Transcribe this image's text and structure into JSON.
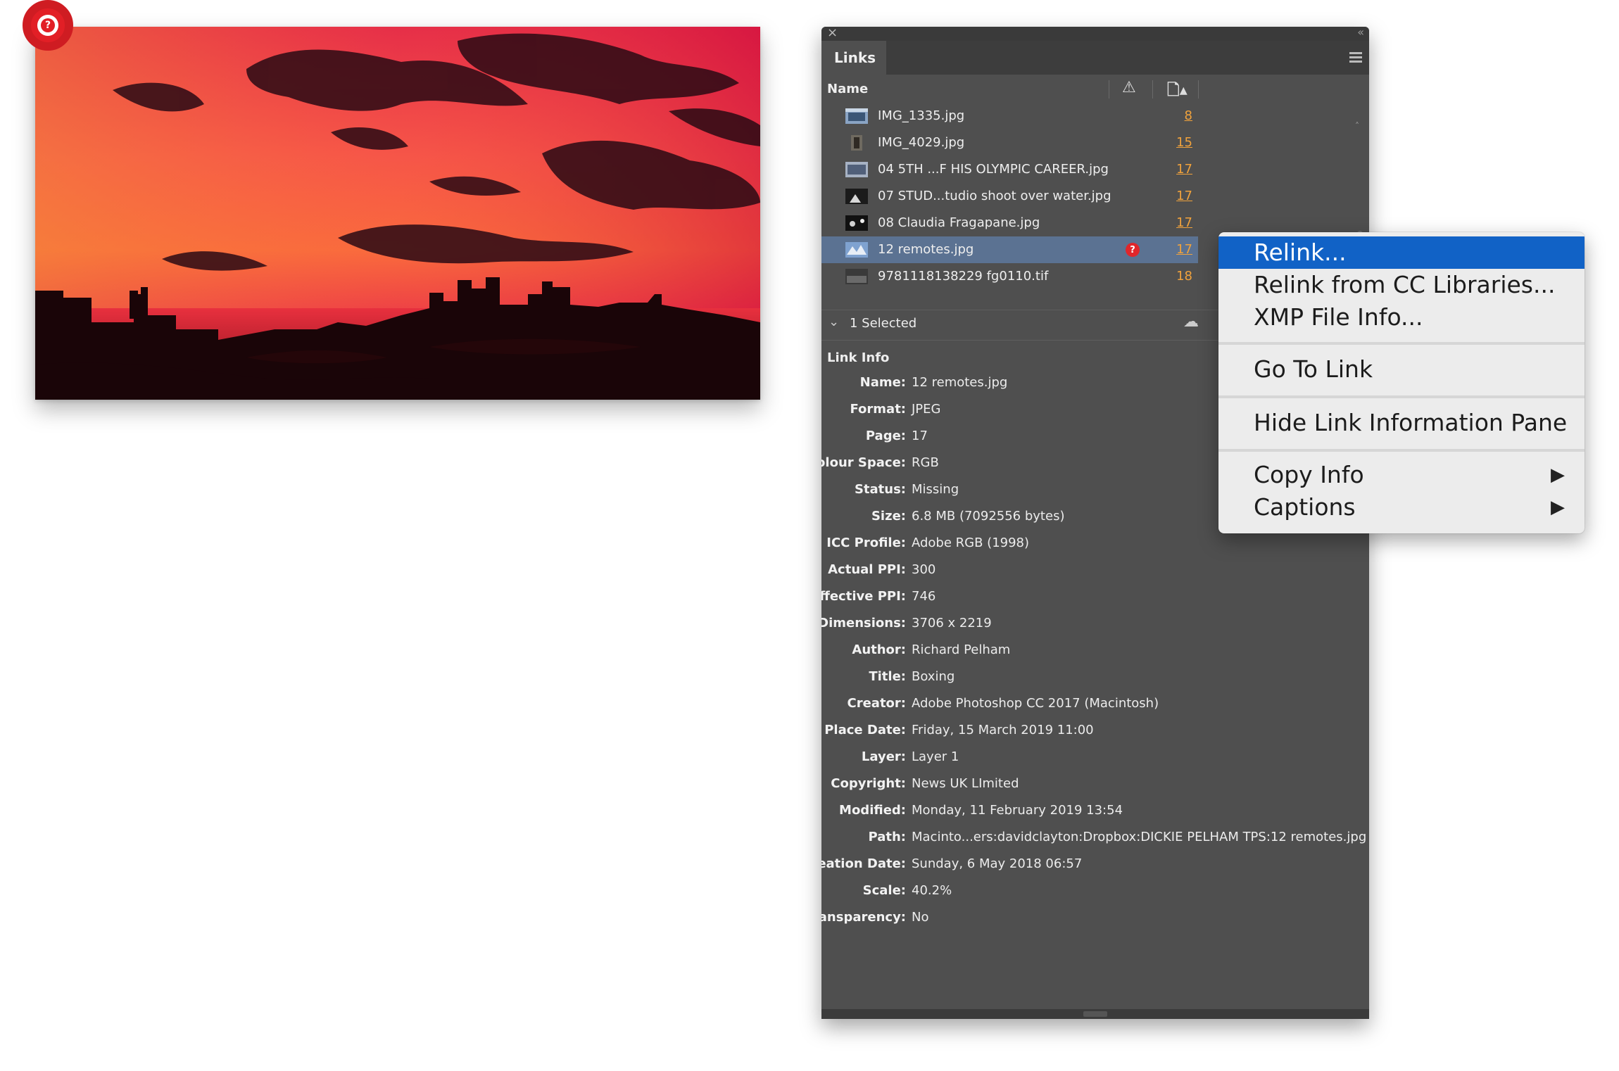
{
  "panel": {
    "tab_label": "Links",
    "column_name": "Name",
    "links": [
      {
        "name": "IMG_1335.jpg",
        "page": "8"
      },
      {
        "name": "IMG_4029.jpg",
        "page": "15"
      },
      {
        "name": "04 5TH ...F HIS OLYMPIC CAREER.jpg",
        "page": "17"
      },
      {
        "name": "07 STUD...tudio shoot over water.jpg",
        "page": "17"
      },
      {
        "name": "08 Claudia Fragapane.jpg",
        "page": "17"
      },
      {
        "name": "12 remotes.jpg",
        "page": "17",
        "status": "missing",
        "selected": true
      },
      {
        "name": "9781118138229 fg0110.tif",
        "page": "18"
      }
    ],
    "selection_label": "1 Selected",
    "link_info_heading": "Link Info",
    "link_info": [
      {
        "key": "Name:",
        "value": "12 remotes.jpg"
      },
      {
        "key": "Format:",
        "value": "JPEG"
      },
      {
        "key": "Page:",
        "value": "17"
      },
      {
        "key": "Colour Space:",
        "value": "RGB"
      },
      {
        "key": "Status:",
        "value": "Missing"
      },
      {
        "key": "Size:",
        "value": "6.8 MB (7092556 bytes)"
      },
      {
        "key": "ICC Profile:",
        "value": "Adobe RGB (1998)"
      },
      {
        "key": "Actual PPI:",
        "value": "300"
      },
      {
        "key": "Effective PPI:",
        "value": "746"
      },
      {
        "key": "Dimensions:",
        "value": "3706 x 2219"
      },
      {
        "key": "Author:",
        "value": "Richard Pelham"
      },
      {
        "key": "Title:",
        "value": "Boxing"
      },
      {
        "key": "Creator:",
        "value": "Adobe Photoshop CC 2017 (Macintosh)"
      },
      {
        "key": "Place Date:",
        "value": "Friday, 15 March 2019 11:00"
      },
      {
        "key": "Layer:",
        "value": "Layer 1"
      },
      {
        "key": "Copyright:",
        "value": "News UK LImited"
      },
      {
        "key": "Modified:",
        "value": "Monday, 11 February 2019 13:54"
      },
      {
        "key": "Path:",
        "value": "Macinto...ers:davidclayton:Dropbox:DICKIE PELHAM TPS:12 remotes.jpg"
      },
      {
        "key": "Creation Date:",
        "value": "Sunday, 6 May 2018 06:57"
      },
      {
        "key": "Scale:",
        "value": "40.2%"
      },
      {
        "key": "Transparency:",
        "value": "No"
      }
    ]
  },
  "context_menu": {
    "items": [
      {
        "label": "Relink..."
      },
      {
        "label": "Relink from CC Libraries..."
      },
      {
        "label": "XMP File Info..."
      },
      {
        "label": "Go To Link"
      },
      {
        "label": "Hide Link Information Pane"
      },
      {
        "label": "Copy Info"
      },
      {
        "label": "Captions"
      }
    ]
  },
  "colors": {
    "panel_bg": "#4f4f4f",
    "selected_row": "#5b7292",
    "page_link": "#f0a23c",
    "menu_highlight": "#1162c6",
    "missing_badge": "#e21f26"
  },
  "icons": {
    "missing": "?"
  }
}
